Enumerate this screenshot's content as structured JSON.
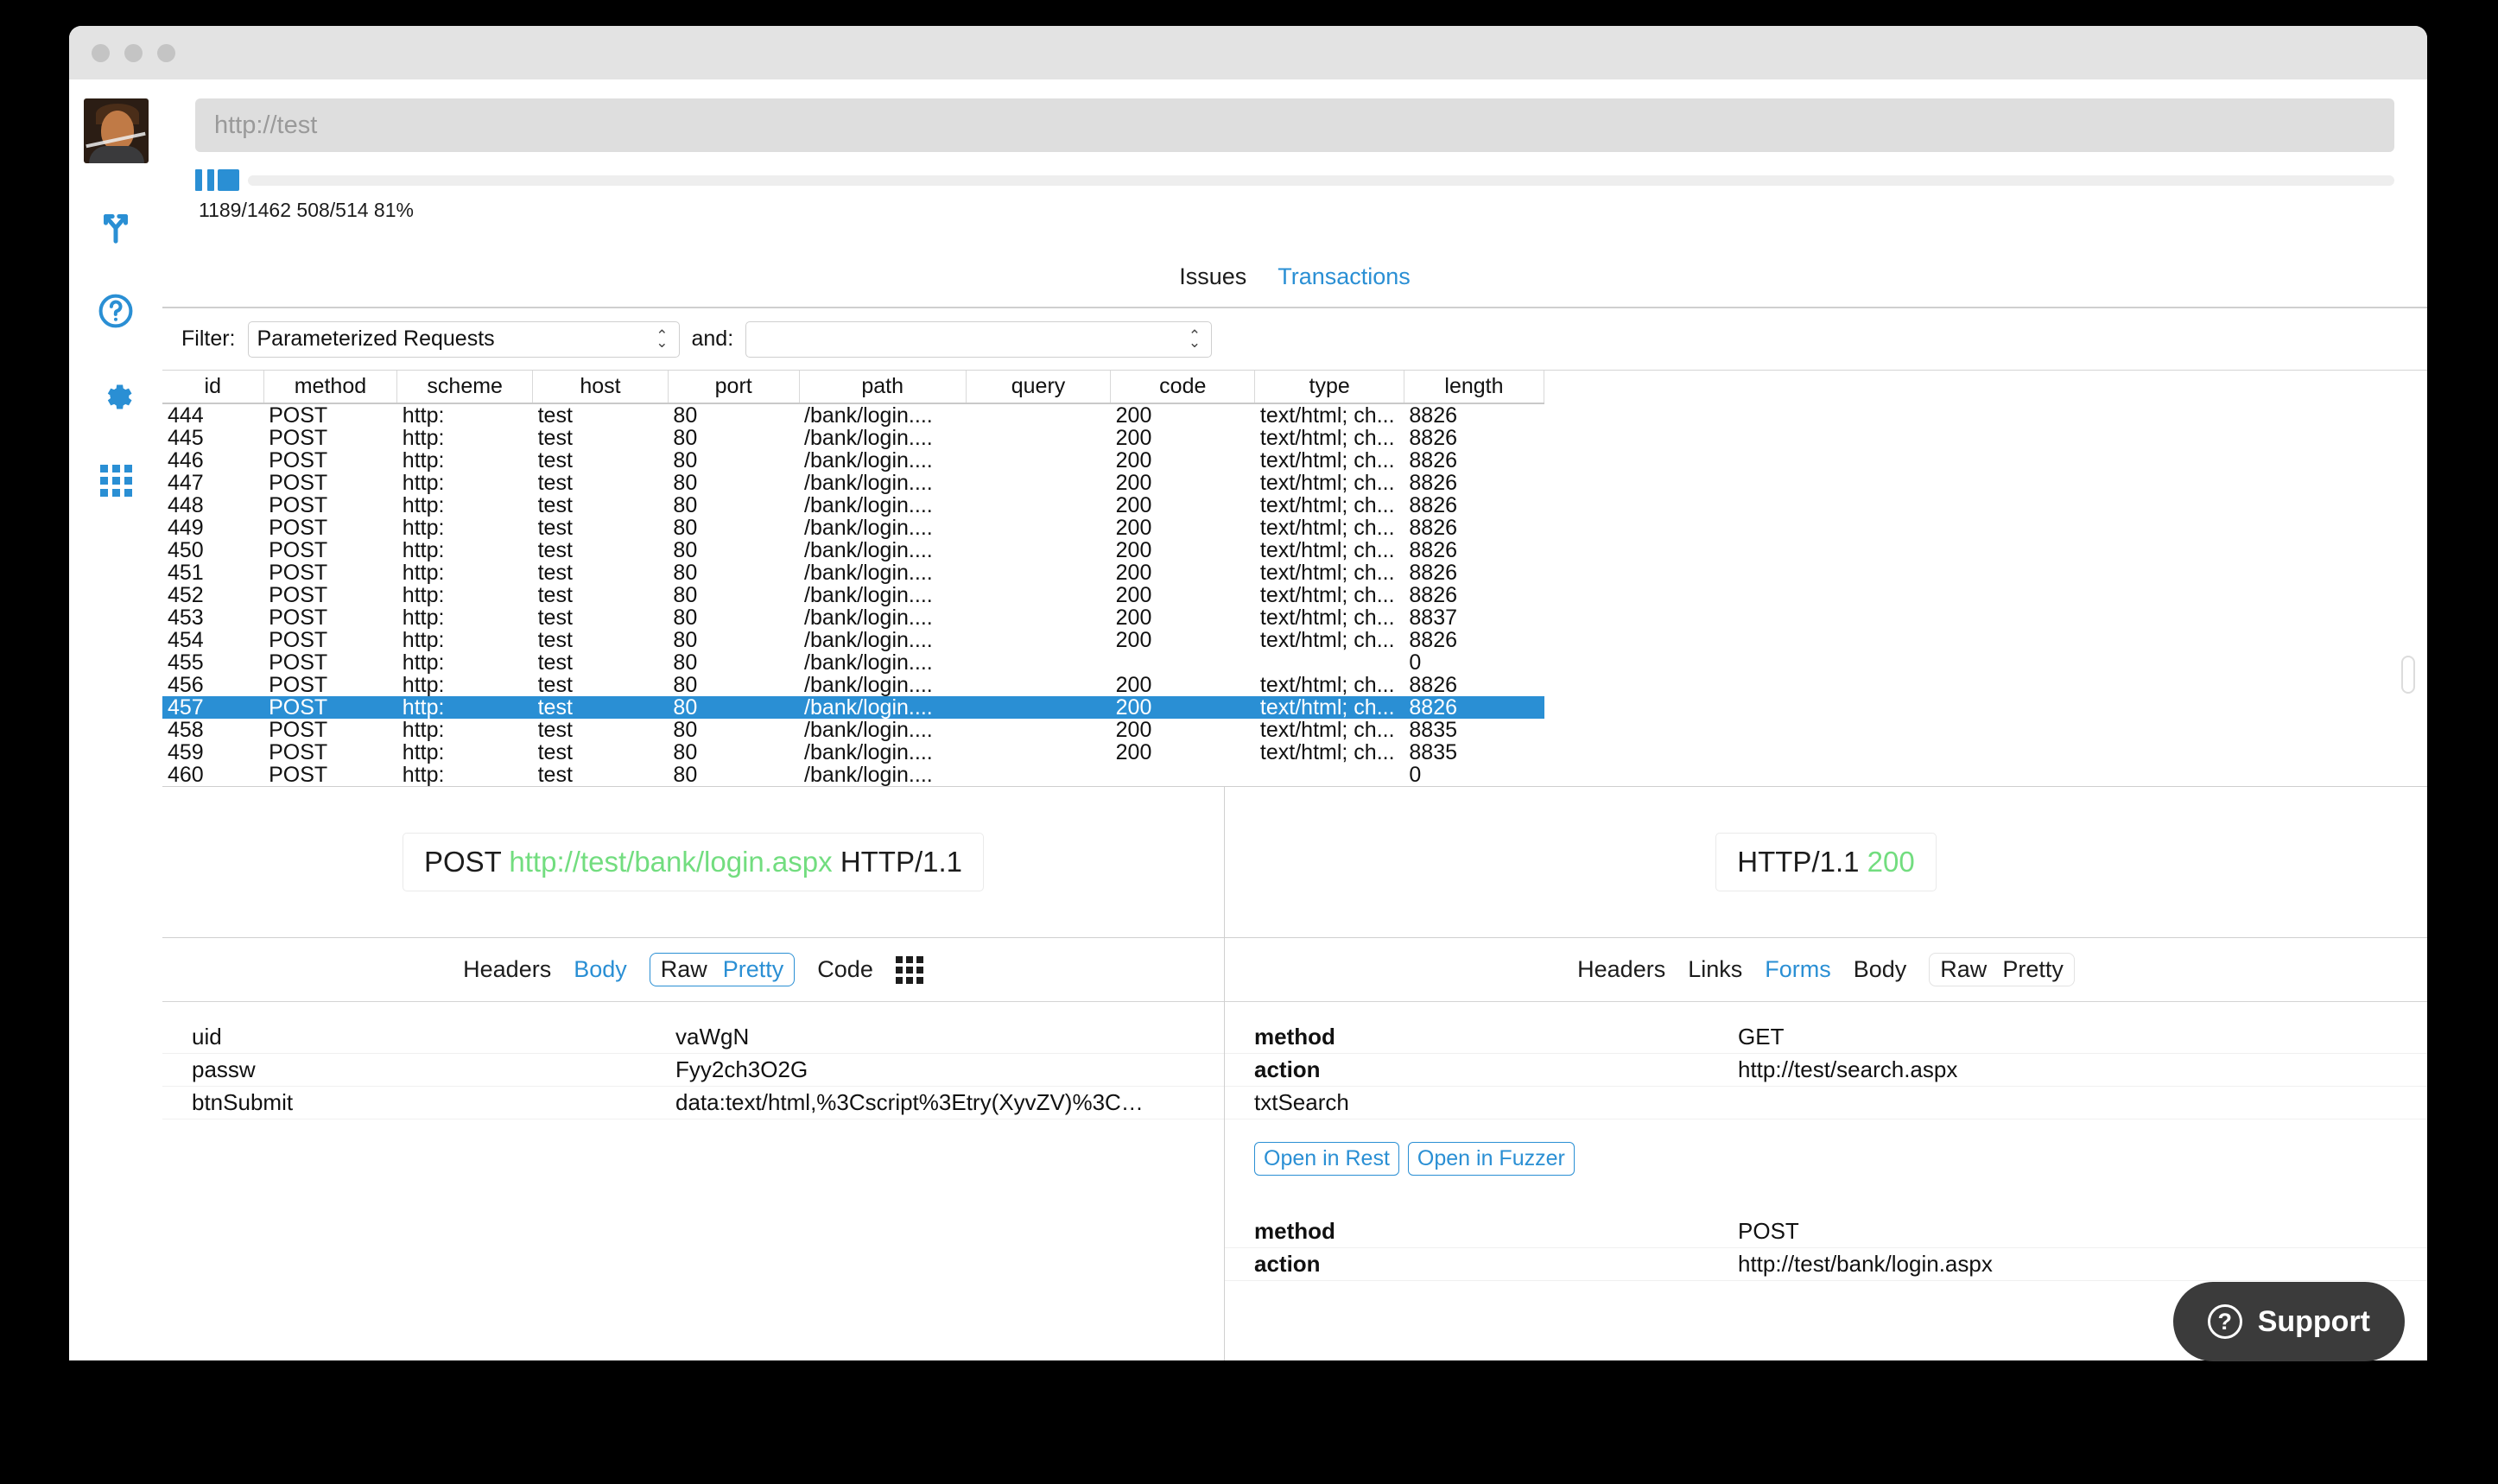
{
  "window": {
    "traffic_lights": [
      "close",
      "minimize",
      "zoom"
    ]
  },
  "sidebar": {
    "items": [
      {
        "name": "avatar",
        "label": "User avatar"
      },
      {
        "name": "branch-icon",
        "label": "Scan / Crawl"
      },
      {
        "name": "help-icon",
        "label": "Help"
      },
      {
        "name": "gear-icon",
        "label": "Settings"
      },
      {
        "name": "grid-icon",
        "label": "Tools"
      }
    ]
  },
  "urlbar": {
    "value": "",
    "placeholder": "http://test"
  },
  "progress": {
    "pause_label": "Pause",
    "stop_label": "Stop",
    "percent": 81,
    "stats": "1189/1462 508/514 81%"
  },
  "toptabs": [
    {
      "label": "Issues",
      "active": false
    },
    {
      "label": "Transactions",
      "active": true
    }
  ],
  "filter": {
    "label": "Filter:",
    "primary_value": "Parameterized Requests",
    "and_label": "and:",
    "secondary_value": ""
  },
  "table": {
    "columns": [
      "id",
      "method",
      "scheme",
      "host",
      "port",
      "path",
      "query",
      "code",
      "type",
      "length"
    ],
    "rows": [
      {
        "id": "444",
        "method": "POST",
        "scheme": "http:",
        "host": "test",
        "port": "80",
        "path": "/bank/login....",
        "query": "",
        "code": "200",
        "type": "text/html; ch...",
        "length": "8826",
        "selected": false
      },
      {
        "id": "445",
        "method": "POST",
        "scheme": "http:",
        "host": "test",
        "port": "80",
        "path": "/bank/login....",
        "query": "",
        "code": "200",
        "type": "text/html; ch...",
        "length": "8826",
        "selected": false
      },
      {
        "id": "446",
        "method": "POST",
        "scheme": "http:",
        "host": "test",
        "port": "80",
        "path": "/bank/login....",
        "query": "",
        "code": "200",
        "type": "text/html; ch...",
        "length": "8826",
        "selected": false
      },
      {
        "id": "447",
        "method": "POST",
        "scheme": "http:",
        "host": "test",
        "port": "80",
        "path": "/bank/login....",
        "query": "",
        "code": "200",
        "type": "text/html; ch...",
        "length": "8826",
        "selected": false
      },
      {
        "id": "448",
        "method": "POST",
        "scheme": "http:",
        "host": "test",
        "port": "80",
        "path": "/bank/login....",
        "query": "",
        "code": "200",
        "type": "text/html; ch...",
        "length": "8826",
        "selected": false
      },
      {
        "id": "449",
        "method": "POST",
        "scheme": "http:",
        "host": "test",
        "port": "80",
        "path": "/bank/login....",
        "query": "",
        "code": "200",
        "type": "text/html; ch...",
        "length": "8826",
        "selected": false
      },
      {
        "id": "450",
        "method": "POST",
        "scheme": "http:",
        "host": "test",
        "port": "80",
        "path": "/bank/login....",
        "query": "",
        "code": "200",
        "type": "text/html; ch...",
        "length": "8826",
        "selected": false
      },
      {
        "id": "451",
        "method": "POST",
        "scheme": "http:",
        "host": "test",
        "port": "80",
        "path": "/bank/login....",
        "query": "",
        "code": "200",
        "type": "text/html; ch...",
        "length": "8826",
        "selected": false
      },
      {
        "id": "452",
        "method": "POST",
        "scheme": "http:",
        "host": "test",
        "port": "80",
        "path": "/bank/login....",
        "query": "",
        "code": "200",
        "type": "text/html; ch...",
        "length": "8826",
        "selected": false
      },
      {
        "id": "453",
        "method": "POST",
        "scheme": "http:",
        "host": "test",
        "port": "80",
        "path": "/bank/login....",
        "query": "",
        "code": "200",
        "type": "text/html; ch...",
        "length": "8837",
        "selected": false
      },
      {
        "id": "454",
        "method": "POST",
        "scheme": "http:",
        "host": "test",
        "port": "80",
        "path": "/bank/login....",
        "query": "",
        "code": "200",
        "type": "text/html; ch...",
        "length": "8826",
        "selected": false
      },
      {
        "id": "455",
        "method": "POST",
        "scheme": "http:",
        "host": "test",
        "port": "80",
        "path": "/bank/login....",
        "query": "",
        "code": "",
        "type": "",
        "length": "0",
        "selected": false
      },
      {
        "id": "456",
        "method": "POST",
        "scheme": "http:",
        "host": "test",
        "port": "80",
        "path": "/bank/login....",
        "query": "",
        "code": "200",
        "type": "text/html; ch...",
        "length": "8826",
        "selected": false
      },
      {
        "id": "457",
        "method": "POST",
        "scheme": "http:",
        "host": "test",
        "port": "80",
        "path": "/bank/login....",
        "query": "",
        "code": "200",
        "type": "text/html; ch...",
        "length": "8826",
        "selected": true
      },
      {
        "id": "458",
        "method": "POST",
        "scheme": "http:",
        "host": "test",
        "port": "80",
        "path": "/bank/login....",
        "query": "",
        "code": "200",
        "type": "text/html; ch...",
        "length": "8835",
        "selected": false
      },
      {
        "id": "459",
        "method": "POST",
        "scheme": "http:",
        "host": "test",
        "port": "80",
        "path": "/bank/login....",
        "query": "",
        "code": "200",
        "type": "text/html; ch...",
        "length": "8835",
        "selected": false
      },
      {
        "id": "460",
        "method": "POST",
        "scheme": "http:",
        "host": "test",
        "port": "80",
        "path": "/bank/login....",
        "query": "",
        "code": "",
        "type": "",
        "length": "0",
        "selected": false
      }
    ]
  },
  "request_pane": {
    "start_line": {
      "method": "POST",
      "url": "http://test/bank/login.aspx",
      "version": "HTTP/1.1"
    },
    "tabs": [
      {
        "label": "Headers",
        "active": false
      },
      {
        "label": "Body",
        "active": true
      },
      {
        "label": "Code",
        "active": false
      }
    ],
    "view_toggle": {
      "raw": "Raw",
      "pretty": "Pretty",
      "selected": "Raw"
    },
    "params": [
      {
        "key": "uid",
        "value": "vaWgN"
      },
      {
        "key": "passw",
        "value": "Fyy2ch3O2G"
      },
      {
        "key": "btnSubmit",
        "value": "data:text/html,%3Cscript%3Etry(XyvZV)%3C…"
      }
    ]
  },
  "response_pane": {
    "start_line": {
      "version": "HTTP/1.1",
      "status": "200"
    },
    "tabs": [
      {
        "label": "Headers",
        "active": false
      },
      {
        "label": "Links",
        "active": false
      },
      {
        "label": "Forms",
        "active": true
      },
      {
        "label": "Body",
        "active": false
      }
    ],
    "view_toggle": {
      "raw": "Raw",
      "pretty": "Pretty",
      "selected": "Raw"
    },
    "forms": [
      {
        "fields": [
          {
            "key": "method",
            "value": "GET",
            "bold": true
          },
          {
            "key": "action",
            "value": "http://test/search.aspx",
            "bold": true
          },
          {
            "key": "txtSearch",
            "value": "",
            "bold": false
          }
        ],
        "buttons": [
          "Open in Rest",
          "Open in Fuzzer"
        ]
      },
      {
        "fields": [
          {
            "key": "method",
            "value": "POST",
            "bold": true
          },
          {
            "key": "action",
            "value": "http://test/bank/login.aspx",
            "bold": true
          }
        ],
        "buttons": []
      }
    ]
  },
  "support_widget": {
    "label": "Support",
    "icon": "question-circle-icon"
  },
  "colors": {
    "accent_blue": "#2a8fd4",
    "selection_blue": "#2a8fd4",
    "status_green": "#72dd7f",
    "support_dark": "#3b3b3b"
  }
}
